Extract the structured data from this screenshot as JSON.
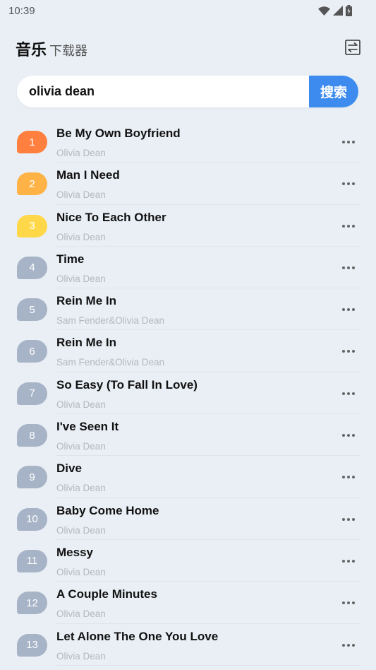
{
  "status_bar": {
    "time": "10:39",
    "icons": [
      "wifi-icon",
      "signal-icon",
      "battery-icon"
    ]
  },
  "header": {
    "title": "音乐",
    "subtitle": "下载器",
    "switch_icon": "swap-icon"
  },
  "search": {
    "value": "olivia dean",
    "button_label": "搜索"
  },
  "colors": {
    "rank_1": "#ff7f3e",
    "rank_2": "#ffb347",
    "rank_3": "#ffd84a",
    "rank_default": "#a7b3c6",
    "accent": "#3d8bef"
  },
  "songs": [
    {
      "rank": "1",
      "title": "Be My Own Boyfriend",
      "artist": "Olivia Dean"
    },
    {
      "rank": "2",
      "title": "Man I Need",
      "artist": "Olivia Dean"
    },
    {
      "rank": "3",
      "title": "Nice To Each Other",
      "artist": "Olivia Dean"
    },
    {
      "rank": "4",
      "title": "Time",
      "artist": "Olivia Dean"
    },
    {
      "rank": "5",
      "title": "Rein Me In",
      "artist": "Sam Fender&Olivia Dean"
    },
    {
      "rank": "6",
      "title": "Rein Me In",
      "artist": "Sam Fender&Olivia Dean"
    },
    {
      "rank": "7",
      "title": "So Easy (To Fall In Love)",
      "artist": "Olivia Dean"
    },
    {
      "rank": "8",
      "title": "I've Seen It",
      "artist": "Olivia Dean"
    },
    {
      "rank": "9",
      "title": "Dive",
      "artist": "Olivia Dean"
    },
    {
      "rank": "10",
      "title": "Baby Come Home",
      "artist": "Olivia Dean"
    },
    {
      "rank": "11",
      "title": "Messy",
      "artist": "Olivia Dean"
    },
    {
      "rank": "12",
      "title": "A Couple Minutes",
      "artist": "Olivia Dean"
    },
    {
      "rank": "13",
      "title": "Let Alone The One You Love",
      "artist": "Olivia Dean"
    }
  ]
}
